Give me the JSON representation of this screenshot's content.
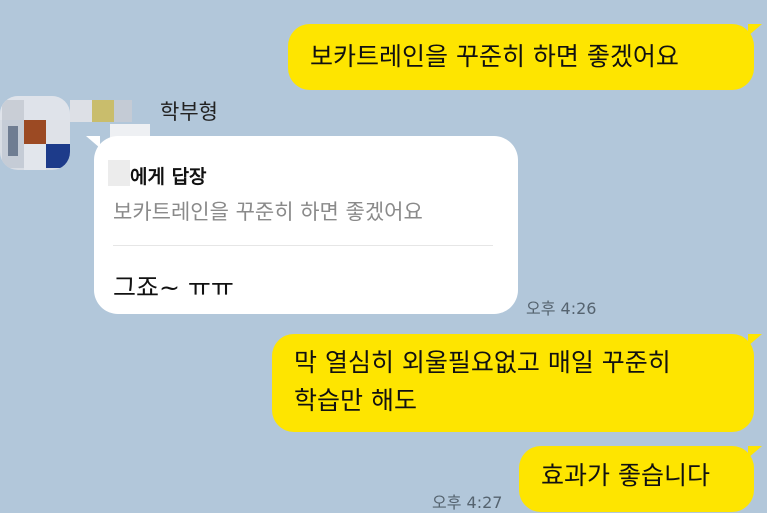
{
  "chat": {
    "messages": [
      {
        "side": "me",
        "text": "보카트레인을 꾸준히 하면 좋겠어요"
      },
      {
        "side": "other",
        "sender": "학부형",
        "reply_to_label": "에게 답장",
        "quoted_text": "보카트레인을 꾸준히 하면 좋겠어요",
        "text": "그죠~ ㅠㅠ",
        "time": "오후 4:26"
      },
      {
        "side": "me",
        "lines": [
          "막 열심히 외울필요없고 매일 꾸준히",
          "학습만 해도"
        ]
      },
      {
        "side": "me",
        "text": "효과가 좋습니다",
        "time": "오후 4:27"
      }
    ]
  },
  "colors": {
    "background": "#b2c7da",
    "my_bubble": "#fee500",
    "other_bubble": "#ffffff"
  }
}
